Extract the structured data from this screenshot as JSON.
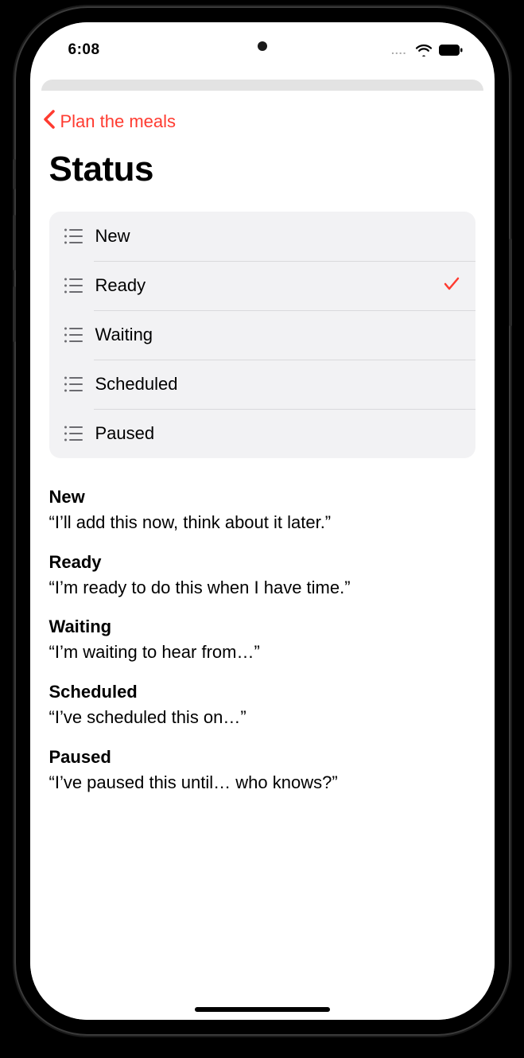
{
  "statusbar": {
    "time": "6:08",
    "dots": "...."
  },
  "nav": {
    "back_label": "Plan the meals"
  },
  "page": {
    "title": "Status"
  },
  "statuses": [
    {
      "label": "New",
      "selected": false
    },
    {
      "label": "Ready",
      "selected": true
    },
    {
      "label": "Waiting",
      "selected": false
    },
    {
      "label": "Scheduled",
      "selected": false
    },
    {
      "label": "Paused",
      "selected": false
    }
  ],
  "descriptions": [
    {
      "title": "New",
      "body": "“I’ll add this now, think about it later.”"
    },
    {
      "title": "Ready",
      "body": "“I’m ready to do this when I have time.”"
    },
    {
      "title": "Waiting",
      "body": "“I’m waiting to hear from…”"
    },
    {
      "title": "Scheduled",
      "body": "“I’ve scheduled this on…”"
    },
    {
      "title": "Paused",
      "body": "“I’ve paused this until… who knows?”"
    }
  ],
  "colors": {
    "accent": "#ff3b30"
  }
}
